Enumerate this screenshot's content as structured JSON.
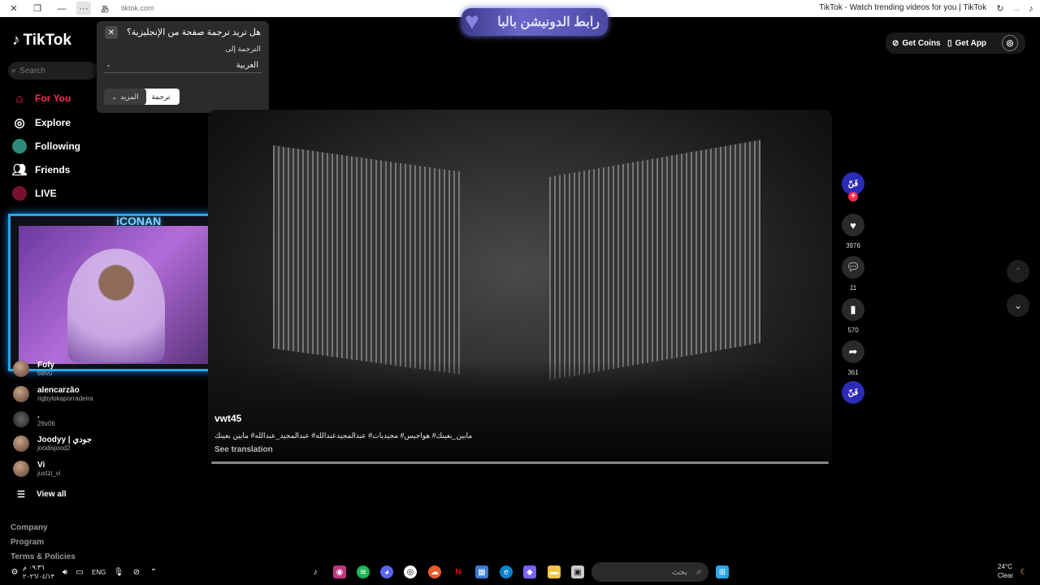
{
  "browser": {
    "url": "tiktok.com",
    "title": "TikTok - Watch trending videos for you | TikTok",
    "more_label": "···"
  },
  "banner": {
    "text": "رابط الدونيشن بالبا"
  },
  "brand": {
    "logo": "TikTok",
    "accent": "#fe2c55"
  },
  "search": {
    "placeholder": "Search"
  },
  "nav": [
    {
      "label": "For You",
      "icon": "home-icon"
    },
    {
      "label": "Explore",
      "icon": "compass-icon"
    },
    {
      "label": "Following",
      "icon": "following-avatar"
    },
    {
      "label": "Friends",
      "icon": "friends-icon"
    },
    {
      "label": "LIVE",
      "icon": "live-icon"
    }
  ],
  "webcam": {
    "brand": "iCONAN"
  },
  "following_accounts": [
    {
      "name": "Fofy",
      "user": "6lilvu"
    },
    {
      "name": "alencarzão",
      "user": "rigbylokaporradeira"
    },
    {
      "name": ".",
      "user": "26v06"
    },
    {
      "name": "Joodyy | جودي",
      "user": "joodisjood2"
    },
    {
      "name": "Vi",
      "user": "justzi_vi"
    }
  ],
  "view_all": "View all",
  "footer": [
    "Company",
    "Program",
    "Terms & Policies"
  ],
  "translate_popup": {
    "question": "هل تريد ترجمة صفحة من الإنجليزية؟",
    "translate_to": "الترجمة إلى",
    "language": "العربية",
    "translate_button": "ترجمة",
    "more_button": "المزيد"
  },
  "video": {
    "author": "vwt45",
    "description": "مابين_بعينك# هواجيس# مجيديات# عبدالمجيدعبدالله# عبدالمجيد_عبدالله# مابين بعينك",
    "see_translation": "See translation",
    "likes": "3976",
    "comments": "11",
    "saves": "570",
    "shares": "361",
    "creator_avatar_text": "فَنّ",
    "progress": 1.0
  },
  "top_right": {
    "get_coins": "Get Coins",
    "get_app": "Get App"
  },
  "taskbar": {
    "lang": "ENG",
    "time": "٠٩:٣٦ م",
    "date": "٢٠٢٦/٠٤/١٣",
    "search_placeholder": "بحث",
    "weather_temp": "24°C",
    "weather_desc": "Clear"
  }
}
